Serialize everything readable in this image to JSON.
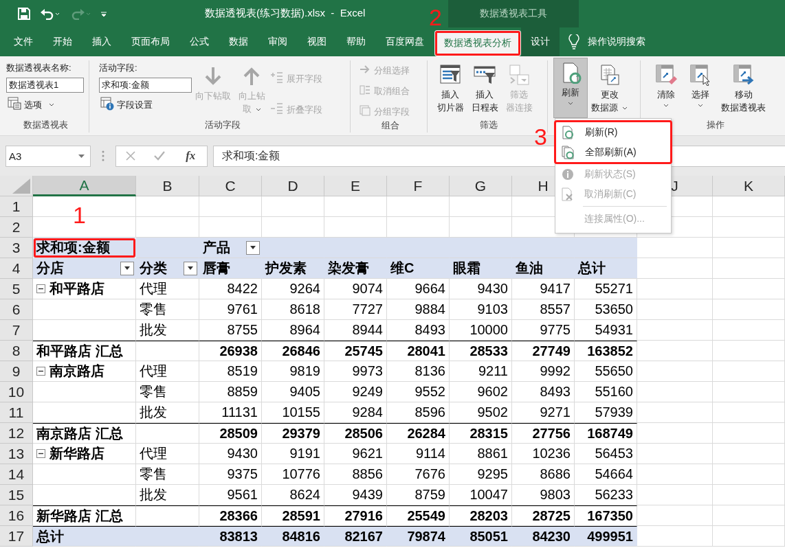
{
  "title_bar": {
    "title": "数据透视表(练习数据).xlsx  -  Excel",
    "tool_group": "数据透视表工具"
  },
  "tabs": [
    {
      "label": "文件",
      "selected": false,
      "highlighted": false,
      "contextual": false
    },
    {
      "label": "开始",
      "selected": false,
      "highlighted": false,
      "contextual": false
    },
    {
      "label": "插入",
      "selected": false,
      "highlighted": false,
      "contextual": false
    },
    {
      "label": "页面布局",
      "selected": false,
      "highlighted": false,
      "contextual": false
    },
    {
      "label": "公式",
      "selected": false,
      "highlighted": false,
      "contextual": false
    },
    {
      "label": "数据",
      "selected": false,
      "highlighted": false,
      "contextual": false
    },
    {
      "label": "审阅",
      "selected": false,
      "highlighted": false,
      "contextual": false
    },
    {
      "label": "视图",
      "selected": false,
      "highlighted": false,
      "contextual": false
    },
    {
      "label": "帮助",
      "selected": false,
      "highlighted": false,
      "contextual": false
    },
    {
      "label": "百度网盘",
      "selected": false,
      "highlighted": false,
      "contextual": false
    },
    {
      "label": "数据透视表分析",
      "selected": true,
      "highlighted": true,
      "contextual": true
    },
    {
      "label": "设计",
      "selected": false,
      "highlighted": false,
      "contextual": true
    }
  ],
  "tell_me": "操作说明搜索",
  "ribbon": {
    "pivot_table": {
      "name_label": "数据透视表名称:",
      "name": "数据透视表1",
      "options": "选项",
      "group_label": "数据透视表"
    },
    "active_field": {
      "field_label": "活动字段:",
      "field": "求和项:金额",
      "settings": "字段设置",
      "drill_down": {
        "lines": [
          "向下钻取"
        ],
        "disabled": true
      },
      "drill_up": {
        "lines": [
          "向上钻",
          "取"
        ],
        "disabled": true,
        "dropdown": true
      },
      "expand": {
        "label": "展开字段",
        "disabled": true
      },
      "collapse": {
        "label": "折叠字段",
        "disabled": true
      },
      "group_label": "活动字段"
    },
    "group": {
      "buttons": [
        {
          "label": "分组选择",
          "disabled": true
        },
        {
          "label": "取消组合",
          "disabled": true
        },
        {
          "label": "分组字段",
          "disabled": true
        }
      ],
      "group_label": "组合"
    },
    "filter": {
      "buttons": [
        {
          "lines": [
            "插入",
            "切片器"
          ],
          "disabled": false,
          "dropdown": false,
          "pressed": false
        },
        {
          "lines": [
            "插入",
            "日程表"
          ],
          "disabled": false,
          "dropdown": false,
          "pressed": false
        },
        {
          "lines": [
            "筛选",
            "器连接"
          ],
          "disabled": true,
          "dropdown": false,
          "pressed": false
        }
      ],
      "group_label": "筛选"
    },
    "data": {
      "buttons": [
        {
          "lines": [
            "刷新"
          ],
          "disabled": false,
          "dropdown": true,
          "pressed": true
        },
        {
          "lines": [
            "更改",
            "数据源"
          ],
          "disabled": false,
          "dropdown": true,
          "pressed": false
        }
      ]
    },
    "actions": {
      "buttons": [
        {
          "lines": [
            "清除"
          ],
          "disabled": false,
          "dropdown": true,
          "pressed": false
        },
        {
          "lines": [
            "选择"
          ],
          "disabled": false,
          "dropdown": true,
          "pressed": false
        },
        {
          "lines": [
            "移动",
            "数据透视表"
          ],
          "disabled": false,
          "dropdown": false,
          "pressed": false
        }
      ],
      "group_label": "操作"
    }
  },
  "formula_bar": {
    "name_box": "A3",
    "fx_label": "fx",
    "formula": "求和项:金额"
  },
  "refresh_menu": {
    "items": [
      {
        "label": "刷新(R)",
        "disabled": false,
        "highlighted": true,
        "separator_before": false
      },
      {
        "label": "全部刷新(A)",
        "disabled": false,
        "highlighted": true,
        "separator_before": false
      },
      {
        "label": "刷新状态(S)",
        "disabled": true,
        "highlighted": false,
        "separator_before": false
      },
      {
        "label": "取消刷新(C)",
        "disabled": true,
        "highlighted": false,
        "separator_before": false
      },
      {
        "label": "连接属性(O)...",
        "disabled": true,
        "highlighted": false,
        "separator_before": true
      }
    ]
  },
  "annotations": [
    {
      "label": "1"
    },
    {
      "label": "2"
    },
    {
      "label": "3"
    }
  ],
  "sheet": {
    "columns": [
      {
        "label": "A",
        "selected": true
      },
      {
        "label": "B",
        "selected": false
      },
      {
        "label": "C",
        "selected": false
      },
      {
        "label": "D",
        "selected": false
      },
      {
        "label": "E",
        "selected": false
      },
      {
        "label": "F",
        "selected": false
      },
      {
        "label": "G",
        "selected": false
      },
      {
        "label": "H",
        "selected": false
      },
      {
        "label": "J",
        "selected": false
      },
      {
        "label": "K",
        "selected": false
      }
    ],
    "row_numbers": [
      "1",
      "2",
      "3",
      "4",
      "5",
      "6",
      "7",
      "8",
      "9",
      "10",
      "11",
      "12",
      "13",
      "14",
      "15",
      "16",
      "17"
    ]
  },
  "pivot": {
    "value_label": "求和项:金额",
    "value_label_highlighted": true,
    "column_field": "产品",
    "row_fields": [
      "分店",
      "分类"
    ],
    "products": [
      "唇膏",
      "护发素",
      "染发膏",
      "维C",
      "眼霜",
      "鱼油",
      "总计"
    ],
    "stores": [
      {
        "name": "和平路店",
        "expanded": true,
        "rows": [
          {
            "category": "代理",
            "values": [
              "8422",
              "9264",
              "9074",
              "9664",
              "9430",
              "9417",
              "55271"
            ]
          },
          {
            "category": "零售",
            "values": [
              "9761",
              "8618",
              "7727",
              "9884",
              "9103",
              "8557",
              "53650"
            ]
          },
          {
            "category": "批发",
            "values": [
              "8755",
              "8964",
              "8944",
              "8493",
              "10000",
              "9775",
              "54931"
            ]
          }
        ],
        "subtotal_label": "和平路店 汇总",
        "subtotals": [
          "26938",
          "26846",
          "25745",
          "28041",
          "28533",
          "27749",
          "163852"
        ]
      },
      {
        "name": "南京路店",
        "expanded": true,
        "rows": [
          {
            "category": "代理",
            "values": [
              "8519",
              "9819",
              "9973",
              "8136",
              "9211",
              "9992",
              "55650"
            ]
          },
          {
            "category": "零售",
            "values": [
              "8859",
              "9405",
              "9249",
              "9552",
              "9602",
              "8493",
              "55160"
            ]
          },
          {
            "category": "批发",
            "values": [
              "11131",
              "10155",
              "9284",
              "8596",
              "9502",
              "9271",
              "57939"
            ]
          }
        ],
        "subtotal_label": "南京路店 汇总",
        "subtotals": [
          "28509",
          "29379",
          "28506",
          "26284",
          "28315",
          "27756",
          "168749"
        ]
      },
      {
        "name": "新华路店",
        "expanded": true,
        "rows": [
          {
            "category": "代理",
            "values": [
              "9430",
              "9191",
              "9621",
              "9114",
              "8861",
              "10236",
              "56453"
            ]
          },
          {
            "category": "零售",
            "values": [
              "9375",
              "10776",
              "8856",
              "7676",
              "9295",
              "8686",
              "54664"
            ]
          },
          {
            "category": "批发",
            "values": [
              "9561",
              "8624",
              "9439",
              "8759",
              "10047",
              "9803",
              "56233"
            ]
          }
        ],
        "subtotal_label": "新华路店 汇总",
        "subtotals": [
          "28366",
          "28591",
          "27916",
          "25549",
          "28203",
          "28725",
          "167350"
        ]
      }
    ],
    "grand_total_label": "总计",
    "grand_totals": [
      "83813",
      "84816",
      "82167",
      "79874",
      "85051",
      "84230",
      "499951"
    ]
  }
}
